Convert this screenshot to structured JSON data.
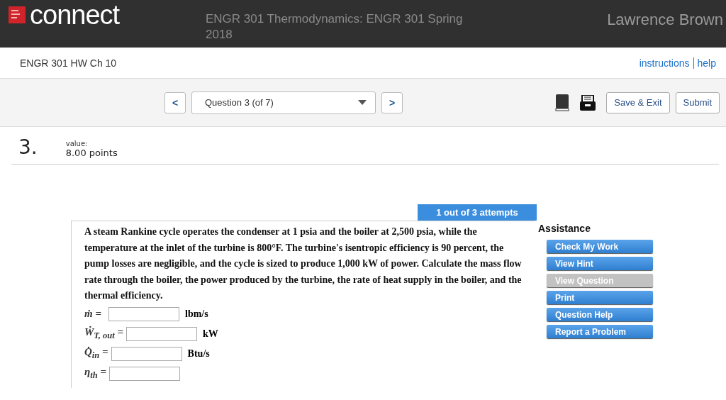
{
  "header": {
    "brand": "connect",
    "course": "ENGR 301 Thermodynamics: ENGR 301 Spring 2018",
    "user": "Lawrence Brown"
  },
  "subheader": {
    "assignment": "ENGR 301 HW Ch 10",
    "links": [
      "instructions",
      "help"
    ]
  },
  "toolbar": {
    "question_select": "Question 3 (of 7)",
    "prev": "<",
    "next": ">",
    "buttons": [
      "Save & Exit",
      "Submit"
    ]
  },
  "question": {
    "number": "3.",
    "value_label": "value:",
    "points": "8.00 points",
    "attempts": "1 out of 3 attempts",
    "text": "A steam Rankine cycle operates the condenser at 1 psia and the boiler at 2,500 psia, while the temperature at the inlet of the turbine is 800°F. The turbine's isentropic efficiency is 90 percent, the pump losses are negligible, and the cycle is sized to produce 1,000 kW of power. Calculate the mass flow rate through the boiler, the power produced by the turbine, the rate of heat supply in the boiler, and the thermal efficiency.",
    "answers": [
      {
        "label": "ṁ =",
        "unit": "lbm/s"
      },
      {
        "label": "Ẇ$_{T, out}$ =",
        "unit": "kW"
      },
      {
        "label": "Q̇$_{in}$ =",
        "unit": "Btu/s"
      },
      {
        "label": "η$_{th}$ ="
      }
    ]
  },
  "assistance": {
    "title": "Assistance",
    "buttons": [
      {
        "label": "Check My Work",
        "disabled": false
      },
      {
        "label": "View Hint",
        "disabled": false
      },
      {
        "label": "View Question",
        "disabled": true
      },
      {
        "label": "Print",
        "disabled": false
      },
      {
        "label": "Question Help",
        "disabled": false
      },
      {
        "label": "Report a Problem",
        "disabled": false
      }
    ]
  }
}
